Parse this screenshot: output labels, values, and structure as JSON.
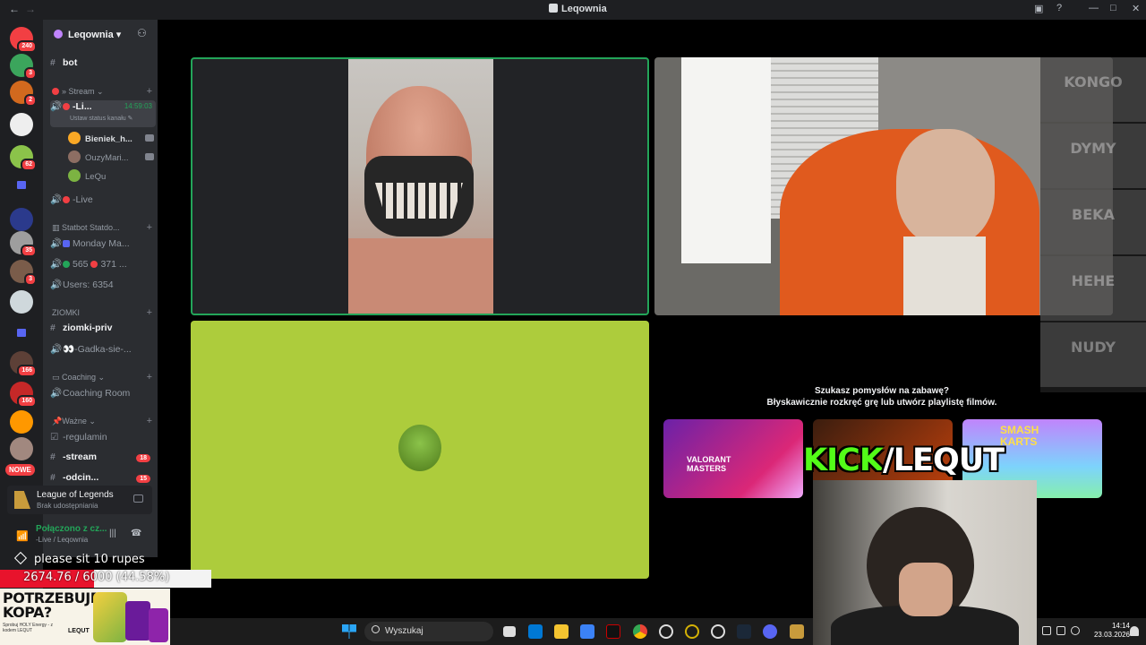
{
  "window": {
    "title": "Leqownia"
  },
  "rail": {
    "servers": [
      {
        "name": "dm",
        "badge": "240",
        "color": "#f23f43"
      },
      {
        "name": "server-2",
        "badge": "3",
        "color": "#3ba55c"
      },
      {
        "name": "server-3",
        "badge": "2",
        "color": "#d2691e"
      },
      {
        "name": "server-4",
        "badge": "",
        "color": "#eeeeee"
      },
      {
        "name": "server-5",
        "badge": "62",
        "color": "#8bc34a"
      },
      {
        "name": "server-6",
        "badge": "",
        "color": "#2b3a8c"
      },
      {
        "name": "server-7",
        "badge": "35",
        "color": "#9e9e9e"
      },
      {
        "name": "server-8",
        "badge": "3",
        "color": "#7a5c4a"
      },
      {
        "name": "server-9",
        "badge": "",
        "color": "#cfd8dc"
      },
      {
        "name": "server-10",
        "badge": "166",
        "color": "#5d4037"
      },
      {
        "name": "server-11",
        "badge": "160",
        "color": "#c62828"
      },
      {
        "name": "server-12",
        "badge": "",
        "color": "#ff9800"
      },
      {
        "name": "server-13",
        "badge": "",
        "color": "#a1887f"
      }
    ],
    "nowe": "NOWE"
  },
  "channels": {
    "server_name": "Leqownia",
    "bot": "bot",
    "cat_stream": "» Stream",
    "live_channel": "-Li...",
    "live_timer": "14:59:03",
    "live_status": "Ustaw status kanału",
    "users": [
      "Bieniek_h...",
      "OuzyMari...",
      "LeQu"
    ],
    "live2": "-Live",
    "cat_statbot": "Statbot Statdo...",
    "stat1": "Monday Ma...",
    "stat2": "565",
    "stat2b": "371 ...",
    "stat3": "Users: 6354",
    "cat_ziomki": "ZIOMKI",
    "ziomki_priv": "ziomki-priv",
    "gadka": "-Gadka-sie-...",
    "cat_coaching": "Coaching",
    "coaching_room": "Coaching Room",
    "cat_wazne": "Ważne",
    "regulamin": "-regulamin",
    "stream_ch": "-stream",
    "stream_badge": "18",
    "odcin_ch": "-odcin...",
    "odcin_badge": "15"
  },
  "activity": {
    "game": "League of Legends",
    "status": "Brak udostępniania"
  },
  "voice": {
    "status": "Połączono z cz...",
    "channel": "-Live / Leqownia"
  },
  "overlay": {
    "nuke_text": "please sit 10 rupes",
    "goal_text": "2674.76 / 6000 (44.58%)",
    "goal_fraction": 0.4458,
    "ad_headline": "POTRZEBUJESZ KOPA?",
    "ad_small": "Sprobuj HOLY Energy - z kodem LEQUT",
    "ad_brand": "LEQUT",
    "kick_a": "KICK",
    "kick_b": "/LEQUT"
  },
  "stage": {
    "memes": [
      "KONGO",
      "DYMY",
      "BEKA",
      "HEHE",
      "NUDY"
    ],
    "prompt_line1": "Szukasz pomysłów na zabawę?",
    "prompt_line2": "Błyskawicznie rozkręć grę lub utwórz playlistę filmów.",
    "cards": [
      "VALORANT MASTERS",
      "",
      "SMASH KARTS"
    ]
  },
  "taskbar": {
    "search": "Wyszukaj",
    "time": "14:14",
    "date": "23.03.2026"
  }
}
